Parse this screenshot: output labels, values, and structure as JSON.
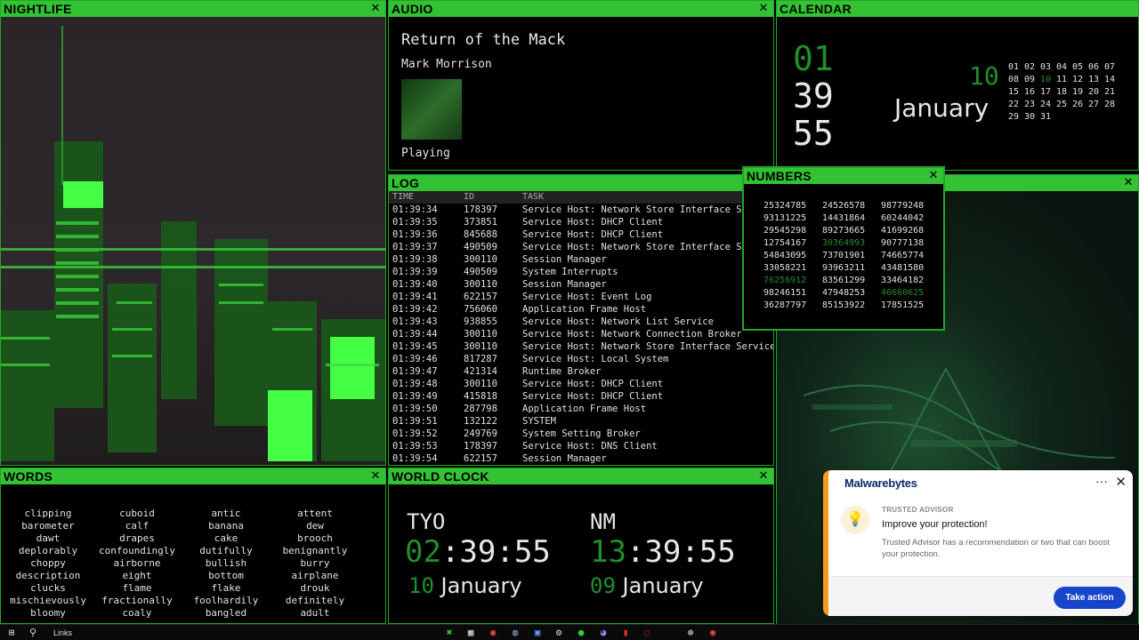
{
  "panels": {
    "nightlife": {
      "title": "NIGHTLIFE"
    },
    "audio": {
      "title": "AUDIO",
      "song": "Return of the Mack",
      "artist": "Mark Morrison",
      "status": "Playing"
    },
    "calendar": {
      "title": "CALENDAR",
      "hour": "01",
      "minute": "39",
      "second": "55",
      "day": "10",
      "month": "January",
      "days": [
        "01",
        "02",
        "03",
        "04",
        "05",
        "06",
        "07",
        "08",
        "09",
        "10",
        "11",
        "12",
        "13",
        "14",
        "15",
        "16",
        "17",
        "18",
        "19",
        "20",
        "21",
        "22",
        "23",
        "24",
        "25",
        "26",
        "27",
        "28",
        "29",
        "30",
        "31"
      ],
      "highlight_day": "10"
    },
    "log": {
      "title": "LOG",
      "headers": {
        "time": "TIME",
        "id": "ID",
        "task": "TASK"
      },
      "rows": [
        {
          "time": "01:39:34",
          "id": "178397",
          "task": "Service Host: Network Store Interface Ser"
        },
        {
          "time": "01:39:35",
          "id": "373851",
          "task": "Service Host: DHCP Client"
        },
        {
          "time": "01:39:36",
          "id": "845688",
          "task": "Service Host: DHCP Client"
        },
        {
          "time": "01:39:37",
          "id": "490509",
          "task": "Service Host: Network Store Interface Ser"
        },
        {
          "time": "01:39:38",
          "id": "300110",
          "task": "Session Manager"
        },
        {
          "time": "01:39:39",
          "id": "490509",
          "task": "System Interrupts"
        },
        {
          "time": "01:39:40",
          "id": "300110",
          "task": "Session Manager"
        },
        {
          "time": "01:39:41",
          "id": "622157",
          "task": "Service Host: Event Log"
        },
        {
          "time": "01:39:42",
          "id": "756060",
          "task": "Application Frame Host"
        },
        {
          "time": "01:39:43",
          "id": "938855",
          "task": "Service Host: Network List Service"
        },
        {
          "time": "01:39:44",
          "id": "300110",
          "task": "Service Host: Network Connection Broker"
        },
        {
          "time": "01:39:45",
          "id": "300110",
          "task": "Service Host: Network Store Interface Service"
        },
        {
          "time": "01:39:46",
          "id": "817287",
          "task": "Service Host: Local System"
        },
        {
          "time": "01:39:47",
          "id": "421314",
          "task": "Runtime Broker"
        },
        {
          "time": "01:39:48",
          "id": "300110",
          "task": "Service Host: DHCP Client"
        },
        {
          "time": "01:39:49",
          "id": "415818",
          "task": "Service Host: DHCP Client"
        },
        {
          "time": "01:39:50",
          "id": "287798",
          "task": "Application Frame Host"
        },
        {
          "time": "01:39:51",
          "id": "132122",
          "task": "SYSTEM"
        },
        {
          "time": "01:39:52",
          "id": "249769",
          "task": "System Setting Broker"
        },
        {
          "time": "01:39:53",
          "id": "178397",
          "task": "Service Host: DNS Client"
        },
        {
          "time": "01:39:54",
          "id": "622157",
          "task": "Session Manager"
        }
      ]
    },
    "numbers": {
      "title": "NUMBERS",
      "rows": [
        [
          "25324785",
          "24526578",
          "98779248"
        ],
        [
          "93131225",
          "14431864",
          "60244042"
        ],
        [
          "29545298",
          "89273665",
          "41699268"
        ],
        [
          "12754167",
          "30364993",
          "90777138"
        ],
        [
          "54843095",
          "73701901",
          "74665774"
        ],
        [
          "33058221",
          "93963211",
          "43481580"
        ],
        [
          "76256912",
          "83561299",
          "33464182"
        ],
        [
          "98246151",
          "47948253",
          "46660625"
        ],
        [
          "36287797",
          "85153922",
          "17851525"
        ]
      ],
      "highlighted": [
        "30364993",
        "76256912",
        "46660625"
      ]
    },
    "words": {
      "title": "WORDS",
      "items": [
        "clipping",
        "cuboid",
        "antic",
        "attent",
        "barometer",
        "calf",
        "banana",
        "dew",
        "dawt",
        "drapes",
        "cake",
        "brooch",
        "deplorably",
        "confoundingly",
        "dutifully",
        "benignantly",
        "choppy",
        "airborne",
        "bullish",
        "burry",
        "description",
        "eight",
        "bottom",
        "airplane",
        "clucks",
        "flame",
        "flake",
        "drouk",
        "mischievously",
        "fractionally",
        "foolhardily",
        "definitely",
        "bloomy",
        "coaly",
        "bangled",
        "adult"
      ]
    },
    "worldclock": {
      "title": "WORLD CLOCK",
      "clocks": [
        {
          "city": "TYO",
          "hour": "02",
          "rest": ":39:55",
          "day": "10",
          "month": "January"
        },
        {
          "city": "NM",
          "hour": "13",
          "rest": ":39:55",
          "day": "09",
          "month": "January"
        }
      ]
    }
  },
  "taskbar": {
    "search_label": "Links"
  },
  "toast": {
    "brand": "Malwarebytes",
    "kicker": "TRUSTED ADVISOR",
    "heading": "Improve your protection!",
    "message": "Trusted Advisor has a recommendation or two that can boost your protection.",
    "action": "Take action",
    "more": "···",
    "close": "✕"
  },
  "colors": {
    "accent_green": "#33c233",
    "dim_green": "#1f8f2a",
    "toast_orange": "#f29b1d",
    "toast_button": "#1745c9"
  }
}
